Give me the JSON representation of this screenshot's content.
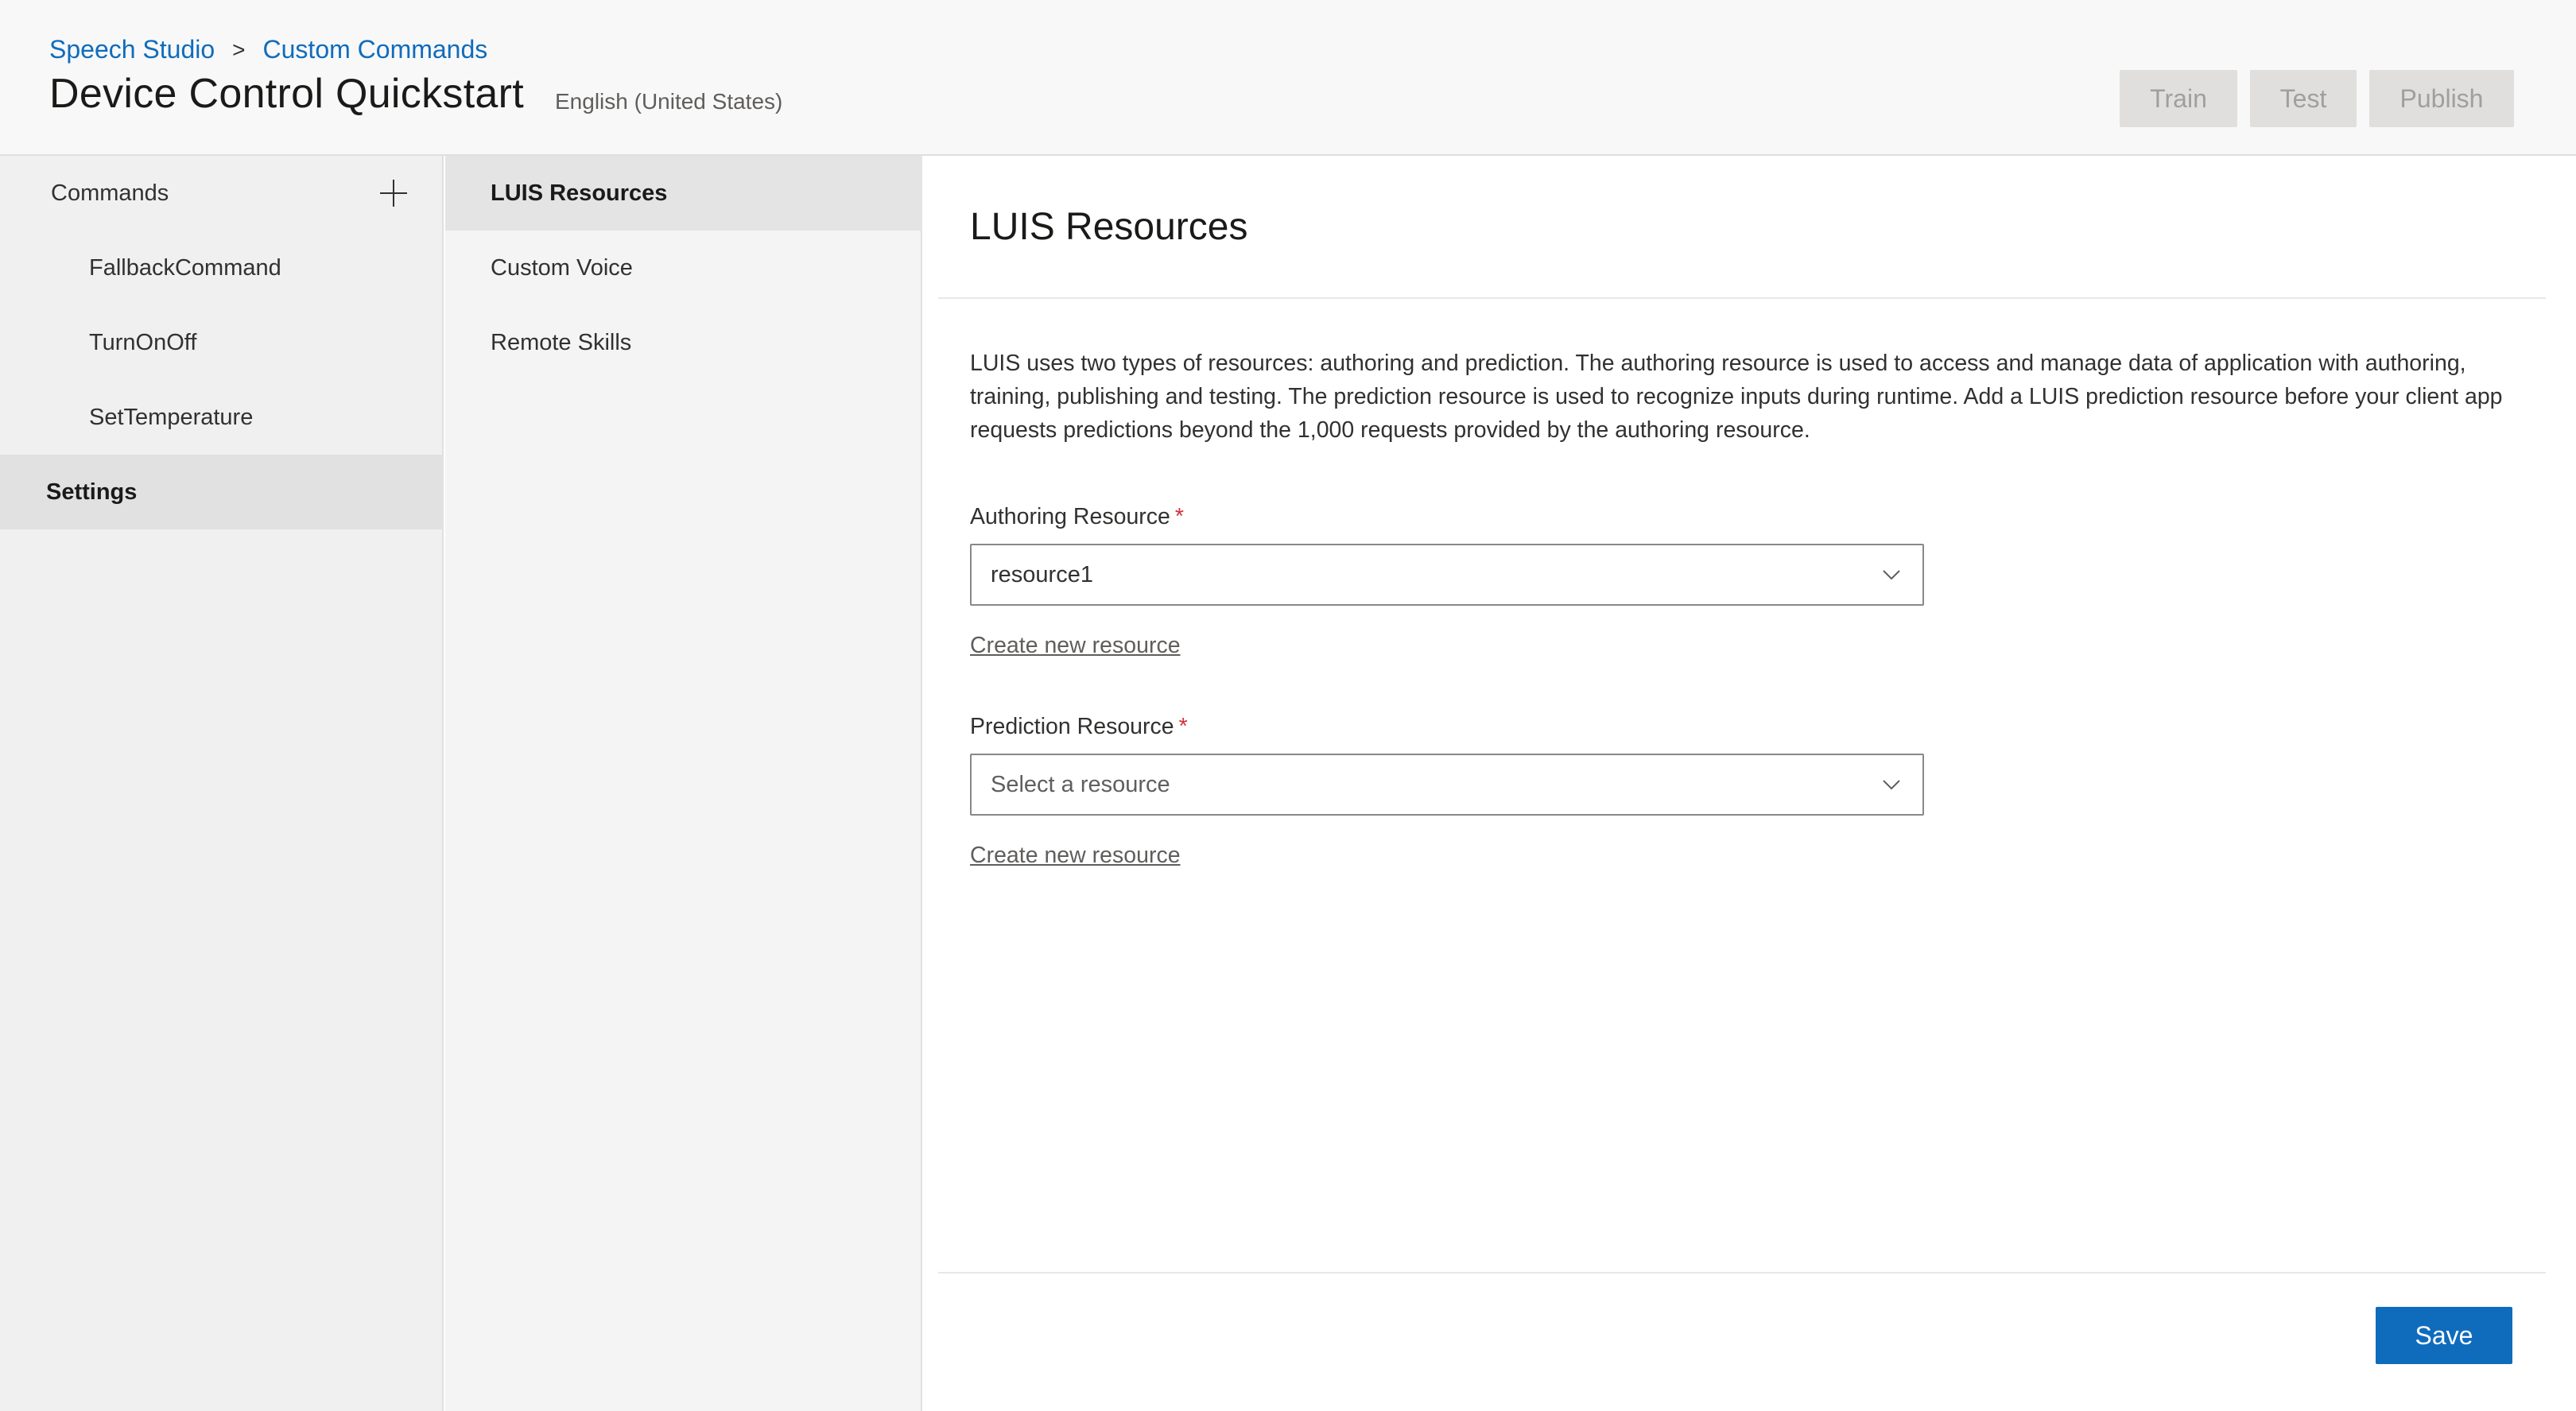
{
  "header": {
    "breadcrumb": [
      "Speech Studio",
      "Custom Commands"
    ],
    "breadcrumb_separator": ">",
    "title": "Device Control Quickstart",
    "locale": "English (United States)",
    "actions": {
      "train": "Train",
      "test": "Test",
      "publish": "Publish"
    }
  },
  "sidebar": {
    "commands_label": "Commands",
    "add_icon": "plus-icon",
    "items": [
      "FallbackCommand",
      "TurnOnOff",
      "SetTemperature"
    ],
    "settings_label": "Settings"
  },
  "settings_nav": {
    "items": [
      "LUIS Resources",
      "Custom Voice",
      "Remote Skills"
    ],
    "active": "LUIS Resources"
  },
  "main": {
    "title": "LUIS Resources",
    "description": "LUIS uses two types of resources: authoring and prediction. The authoring resource is used to access and manage data of application with authoring, training, publishing and testing. The prediction resource is used to recognize inputs during runtime. Add a LUIS prediction resource before your client app requests predictions beyond the 1,000 requests provided by the authoring resource.",
    "authoring": {
      "label": "Authoring Resource",
      "required_mark": "*",
      "value": "resource1",
      "link": "Create new resource"
    },
    "prediction": {
      "label": "Prediction Resource",
      "required_mark": "*",
      "placeholder": "Select a resource",
      "link": "Create new resource"
    },
    "save_label": "Save"
  },
  "colors": {
    "accent": "#0f6cbd",
    "required": "#d13438",
    "disabled_button_bg": "#e1dfdd"
  }
}
